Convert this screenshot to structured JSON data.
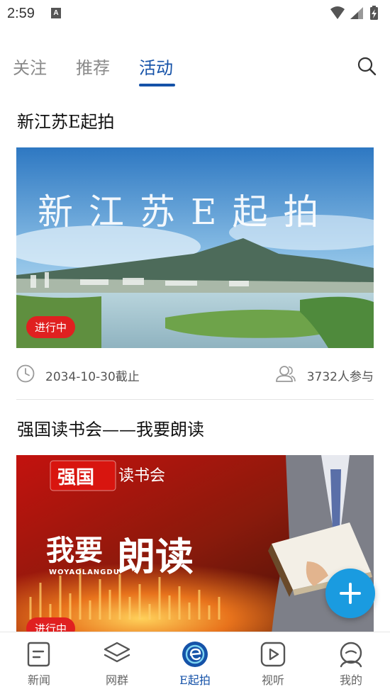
{
  "status_bar": {
    "time": "2:59",
    "notification_letter": "A"
  },
  "tabs": [
    {
      "label": "关注",
      "active": false
    },
    {
      "label": "推荐",
      "active": false
    },
    {
      "label": "活动",
      "active": true
    }
  ],
  "search_icon": "search-icon",
  "cards": [
    {
      "title": "新江苏E起拍",
      "image_caption": "新江苏E起拍",
      "badge": "进行中",
      "deadline": "2034-10-30截止",
      "participants": "3732人参与"
    },
    {
      "title": "强国读书会——我要朗读",
      "image_brand": "强国",
      "image_club": "读书会",
      "image_headline_a": "我要",
      "image_headline_b": "朗读",
      "image_pinyin": "WOYAOLANGDU",
      "badge": "进行中"
    }
  ],
  "fab": {
    "icon": "plus-icon"
  },
  "bottom_nav": [
    {
      "label": "新闻",
      "icon": "news-icon",
      "active": false
    },
    {
      "label": "网群",
      "icon": "layers-icon",
      "active": false
    },
    {
      "label": "E起拍",
      "icon": "e-shoot-icon",
      "active": true
    },
    {
      "label": "视听",
      "icon": "play-icon",
      "active": false
    },
    {
      "label": "我的",
      "icon": "profile-icon",
      "active": false
    }
  ],
  "colors": {
    "accent": "#1552a8",
    "badge": "#e02020",
    "fab": "#1a9be0"
  }
}
